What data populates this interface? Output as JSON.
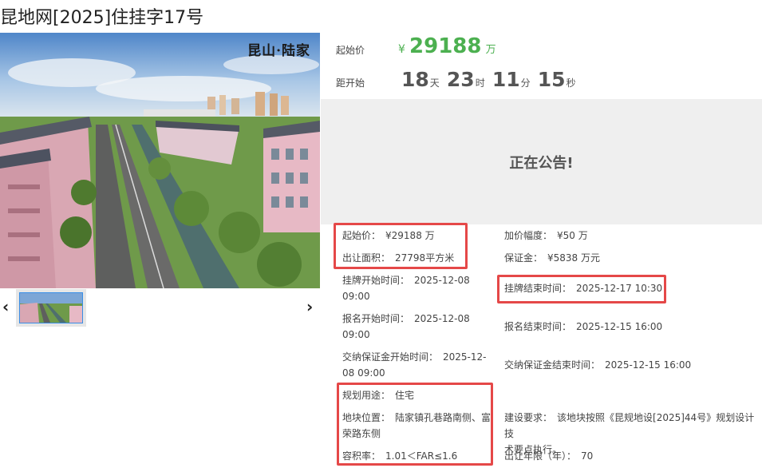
{
  "title": "昆地网[2025]住挂字17号",
  "photo": {
    "caption": "昆山·陆家"
  },
  "nav": {
    "prev": "‹",
    "next": "›"
  },
  "price_panel": {
    "start_label": "起始价",
    "currency": "¥",
    "start_price": "29188",
    "price_unit": "万",
    "countdown_label": "距开始",
    "days": "18",
    "days_unit": "天",
    "hours": "23",
    "hours_unit": "时",
    "minutes": "11",
    "minutes_unit": "分",
    "seconds": "15",
    "seconds_unit": "秒"
  },
  "notice": "正在公告!",
  "info": {
    "start_price": {
      "label": "起始价：",
      "value": "¥29188 万"
    },
    "increment": {
      "label": "加价幅度：",
      "value": "¥50 万"
    },
    "area": {
      "label": "出让面积：",
      "value": "27798平方米"
    },
    "deposit": {
      "label": "保证金：",
      "value": "¥5838 万元"
    },
    "listing_start": {
      "label": "挂牌开始时间：",
      "value": "2025-12-08",
      "value2": "09:00"
    },
    "listing_end": {
      "label": "挂牌结束时间：",
      "value": "2025-12-17 10:30"
    },
    "reg_start": {
      "label": "报名开始时间：",
      "value": "2025-12-08",
      "value2": "09:00"
    },
    "reg_end": {
      "label": "报名结束时间：",
      "value": "2025-12-15 16:00"
    },
    "deposit_start": {
      "label": "交纳保证金开始时间：",
      "value": "2025-12-",
      "value2": "08 09:00"
    },
    "deposit_end": {
      "label": "交纳保证金结束时间：",
      "value": "2025-12-15 16:00"
    },
    "usage": {
      "label": "规划用途：",
      "value": "住宅"
    },
    "location": {
      "label": "地块位置：",
      "value": "陆家镇孔巷路南侧、富",
      "value2": "荣路东侧"
    },
    "build_req": {
      "label": "建设要求：",
      "value": "该地块按照《昆规地设[2025]44号》规划设计技",
      "value2": "术要点执行。"
    },
    "far": {
      "label": "容积率：",
      "value": "1.01＜FAR≤1.6"
    },
    "term": {
      "label": "出让年限（年）：",
      "value": "70"
    }
  },
  "colors": {
    "price_green": "#4cb050",
    "highlight_red": "#e54848",
    "thumb_border": "#3a8ee6"
  }
}
